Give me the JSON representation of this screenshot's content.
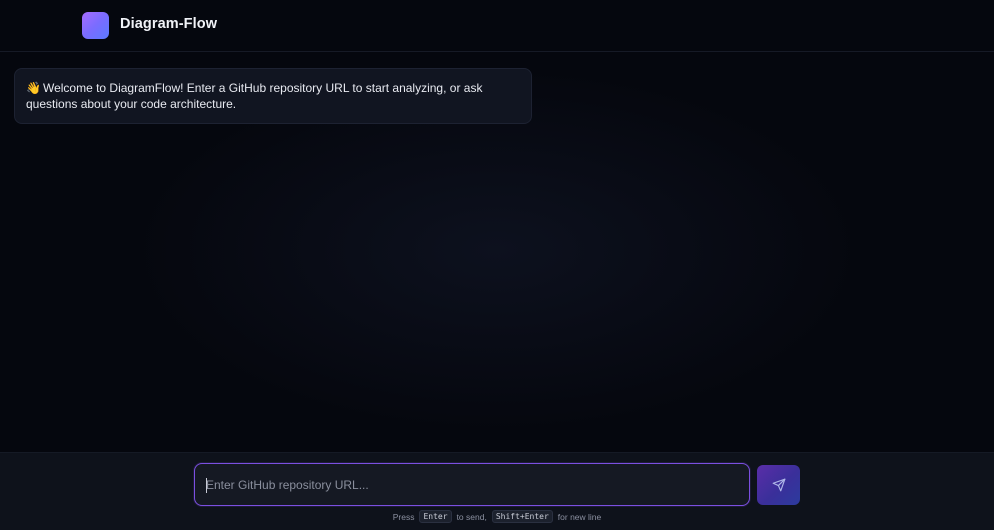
{
  "header": {
    "title": "Diagram-Flow",
    "logo_icon": "gradient-square-logo"
  },
  "chat": {
    "messages": [
      {
        "emoji": "👋",
        "text": "Welcome to DiagramFlow! Enter a GitHub repository URL to start analyzing, or ask questions about your code architecture."
      }
    ]
  },
  "composer": {
    "placeholder": "Enter GitHub repository URL...",
    "value": "",
    "send_icon": "paper-plane-icon",
    "hint": {
      "press": "Press",
      "enter_key": "Enter",
      "to_send": "to send,",
      "shift_enter_key": "Shift+Enter",
      "for_new_line": "for new line"
    }
  },
  "colors": {
    "background": "#05070e",
    "accent": "#7b4fe0",
    "logo_gradient_start": "#a66bff",
    "logo_gradient_end": "#5b7bff"
  }
}
